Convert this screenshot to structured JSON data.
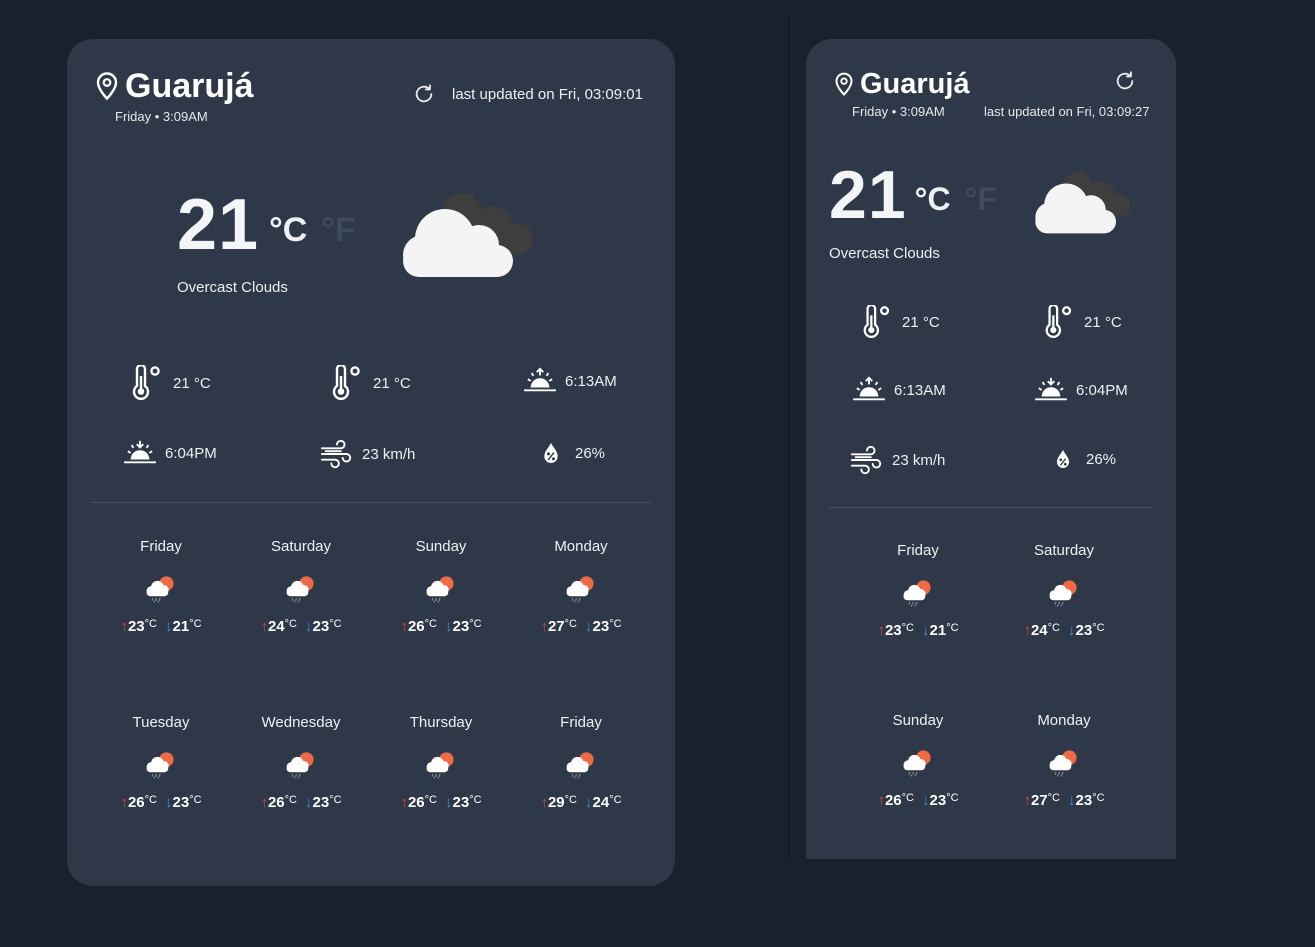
{
  "colors": {
    "background": "#1b212c",
    "card": "#2e3848",
    "arrow_up": "#e0474c",
    "arrow_down": "#3b8fe6",
    "unit_inactive": "#3f4a5b"
  },
  "widgets": [
    {
      "city": "Guarujá",
      "local_time": "Friday • 3:09AM",
      "last_updated": "last updated on Fri, 03:09:01",
      "refresh_icon": "refresh-icon",
      "temperature": "21",
      "unit_celsius": "°C",
      "unit_fahrenheit": "°F",
      "condition": "Overcast Clouds",
      "condition_icon": "overcast-clouds-icon",
      "stats": {
        "feels_like": "21 °C",
        "temp_extra": "21 °C",
        "sunrise": "6:13AM",
        "sunset": "6:04PM",
        "wind": "23 km/h",
        "humidity": "26%"
      },
      "forecast": [
        {
          "day": "Friday",
          "max": "23",
          "min": "21",
          "unit": "°C",
          "icon": "rain-cloud-sun-icon"
        },
        {
          "day": "Saturday",
          "max": "24",
          "min": "23",
          "unit": "°C",
          "icon": "rain-cloud-sun-icon"
        },
        {
          "day": "Sunday",
          "max": "26",
          "min": "23",
          "unit": "°C",
          "icon": "rain-cloud-sun-icon"
        },
        {
          "day": "Monday",
          "max": "27",
          "min": "23",
          "unit": "°C",
          "icon": "rain-cloud-sun-icon"
        },
        {
          "day": "Tuesday",
          "max": "26",
          "min": "23",
          "unit": "°C",
          "icon": "rain-cloud-sun-icon"
        },
        {
          "day": "Wednesday",
          "max": "26",
          "min": "23",
          "unit": "°C",
          "icon": "rain-cloud-sun-icon"
        },
        {
          "day": "Thursday",
          "max": "26",
          "min": "23",
          "unit": "°C",
          "icon": "rain-cloud-sun-icon"
        },
        {
          "day": "Friday",
          "max": "29",
          "min": "24",
          "unit": "°C",
          "icon": "rain-cloud-sun-icon"
        }
      ]
    },
    {
      "city": "Guarujá",
      "local_time": "Friday • 3:09AM",
      "last_updated": "last updated on Fri, 03:09:27",
      "refresh_icon": "refresh-icon",
      "temperature": "21",
      "unit_celsius": "°C",
      "unit_fahrenheit": "°F",
      "condition": "Overcast Clouds",
      "condition_icon": "overcast-clouds-icon",
      "stats": {
        "feels_like": "21 °C",
        "temp_extra": "21 °C",
        "sunrise": "6:13AM",
        "sunset": "6:04PM",
        "wind": "23 km/h",
        "humidity": "26%"
      },
      "forecast": [
        {
          "day": "Friday",
          "max": "23",
          "min": "21",
          "unit": "°C",
          "icon": "rain-cloud-sun-icon"
        },
        {
          "day": "Saturday",
          "max": "24",
          "min": "23",
          "unit": "°C",
          "icon": "rain-cloud-sun-icon"
        },
        {
          "day": "Sunday",
          "max": "26",
          "min": "23",
          "unit": "°C",
          "icon": "rain-cloud-sun-icon"
        },
        {
          "day": "Monday",
          "max": "27",
          "min": "23",
          "unit": "°C",
          "icon": "rain-cloud-sun-icon"
        }
      ]
    }
  ]
}
